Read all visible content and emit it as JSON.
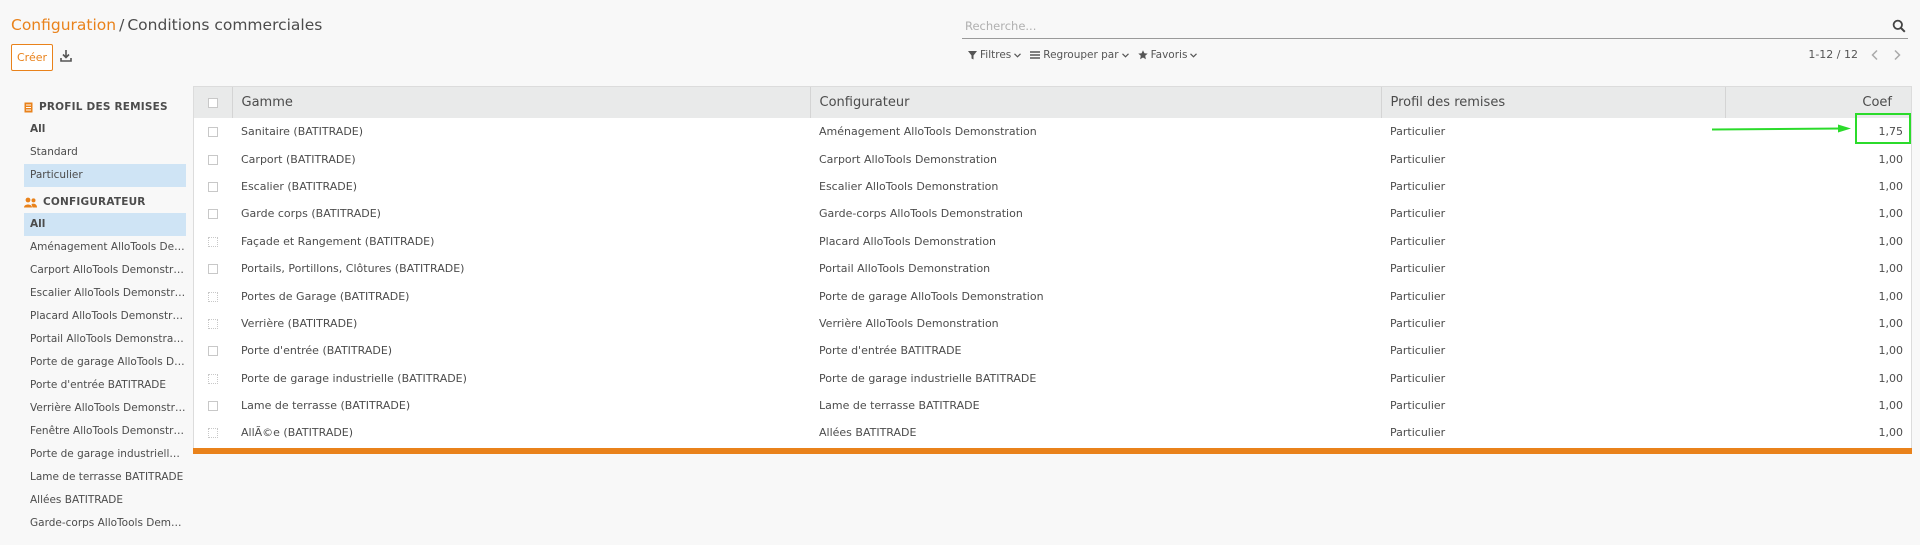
{
  "colors": {
    "accent": "#e9821b",
    "active_bg": "#cfe4f5",
    "annotation": "#2bdb2b"
  },
  "breadcrumb": {
    "parent": "Configuration",
    "separator": "/",
    "current": "Conditions commerciales"
  },
  "toolbar": {
    "create_label": "Créer",
    "download_icon": "download-icon"
  },
  "search": {
    "placeholder": "Recherche...",
    "value": ""
  },
  "filters": {
    "filters_label": "Filtres",
    "group_label": "Regrouper par",
    "favorites_label": "Favoris"
  },
  "pager": {
    "value": "1-12 / 12"
  },
  "sidebar": {
    "profile_header": "PROFIL DES REMISES",
    "profile_items": [
      {
        "label": "All",
        "bold": true,
        "active": false
      },
      {
        "label": "Standard",
        "bold": false,
        "active": false
      },
      {
        "label": "Particulier",
        "bold": false,
        "active": true
      }
    ],
    "config_header": "CONFIGURATEUR",
    "config_items": [
      {
        "label": "All",
        "bold": true,
        "active": true
      },
      {
        "label": "Aménagement AlloTools Demonstration",
        "bold": false,
        "active": false
      },
      {
        "label": "Carport AlloTools Demonstration",
        "bold": false,
        "active": false
      },
      {
        "label": "Escalier AlloTools Demonstration",
        "bold": false,
        "active": false
      },
      {
        "label": "Placard AlloTools Demonstration",
        "bold": false,
        "active": false
      },
      {
        "label": "Portail AlloTools Demonstration",
        "bold": false,
        "active": false
      },
      {
        "label": "Porte de garage AlloTools Demonstration",
        "bold": false,
        "active": false
      },
      {
        "label": "Porte d'entrée BATITRADE",
        "bold": false,
        "active": false
      },
      {
        "label": "Verrière AlloTools Demonstration",
        "bold": false,
        "active": false
      },
      {
        "label": "Fenêtre AlloTools Demonstration",
        "bold": false,
        "active": false
      },
      {
        "label": "Porte de garage industrielle BATITRADE",
        "bold": false,
        "active": false
      },
      {
        "label": "Lame de terrasse BATITRADE",
        "bold": false,
        "active": false
      },
      {
        "label": "Allées BATITRADE",
        "bold": false,
        "active": false
      },
      {
        "label": "Garde-corps AlloTools Demonstration",
        "bold": false,
        "active": false
      }
    ]
  },
  "table": {
    "headers": {
      "gamme": "Gamme",
      "configurateur": "Configurateur",
      "profil": "Profil des remises",
      "coef": "Coef"
    },
    "rows": [
      {
        "gamme": "Sanitaire (BATITRADE)",
        "configurateur": "Aménagement AlloTools Demonstration",
        "profil": "Particulier",
        "coef": "1,75",
        "cb_dotted": false
      },
      {
        "gamme": "Carport (BATITRADE)",
        "configurateur": "Carport AlloTools Demonstration",
        "profil": "Particulier",
        "coef": "1,00",
        "cb_dotted": false
      },
      {
        "gamme": "Escalier (BATITRADE)",
        "configurateur": "Escalier AlloTools Demonstration",
        "profil": "Particulier",
        "coef": "1,00",
        "cb_dotted": false
      },
      {
        "gamme": "Garde corps (BATITRADE)",
        "configurateur": "Garde-corps AlloTools Demonstration",
        "profil": "Particulier",
        "coef": "1,00",
        "cb_dotted": false
      },
      {
        "gamme": "Façade et Rangement (BATITRADE)",
        "configurateur": "Placard AlloTools Demonstration",
        "profil": "Particulier",
        "coef": "1,00",
        "cb_dotted": true
      },
      {
        "gamme": "Portails, Portillons, Clôtures (BATITRADE)",
        "configurateur": "Portail AlloTools Demonstration",
        "profil": "Particulier",
        "coef": "1,00",
        "cb_dotted": false
      },
      {
        "gamme": "Portes de Garage (BATITRADE)",
        "configurateur": "Porte de garage AlloTools Demonstration",
        "profil": "Particulier",
        "coef": "1,00",
        "cb_dotted": true
      },
      {
        "gamme": "Verrière (BATITRADE)",
        "configurateur": "Verrière AlloTools Demonstration",
        "profil": "Particulier",
        "coef": "1,00",
        "cb_dotted": true
      },
      {
        "gamme": "Porte d'entrée (BATITRADE)",
        "configurateur": "Porte d'entrée BATITRADE",
        "profil": "Particulier",
        "coef": "1,00",
        "cb_dotted": false
      },
      {
        "gamme": "Porte de garage industrielle (BATITRADE)",
        "configurateur": "Porte de garage industrielle BATITRADE",
        "profil": "Particulier",
        "coef": "1,00",
        "cb_dotted": true
      },
      {
        "gamme": "Lame de terrasse (BATITRADE)",
        "configurateur": "Lame de terrasse BATITRADE",
        "profil": "Particulier",
        "coef": "1,00",
        "cb_dotted": false
      },
      {
        "gamme": "AllÃ©e (BATITRADE)",
        "configurateur": "Allées BATITRADE",
        "profil": "Particulier",
        "coef": "1,00",
        "cb_dotted": true
      }
    ]
  }
}
